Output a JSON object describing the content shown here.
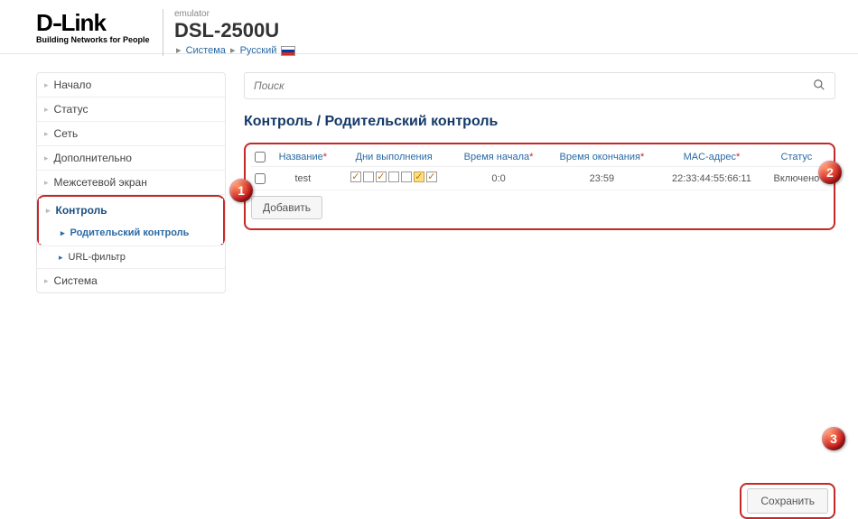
{
  "header": {
    "brand": "D-Link",
    "slogan": "Building Networks for People",
    "emulator": "emulator",
    "model": "DSL-2500U",
    "crumb_system": "Система",
    "crumb_lang": "Русский"
  },
  "sidebar": {
    "items": [
      {
        "label": "Начало"
      },
      {
        "label": "Статус"
      },
      {
        "label": "Сеть"
      },
      {
        "label": "Дополнительно"
      },
      {
        "label": "Межсетевой экран"
      },
      {
        "label": "Контроль"
      },
      {
        "label": "Родительский контроль"
      },
      {
        "label": "URL-фильтр"
      },
      {
        "label": "Система"
      }
    ]
  },
  "search": {
    "placeholder": "Поиск"
  },
  "title": "Контроль /  Родительский контроль",
  "columns": {
    "name": "Название",
    "days": "Дни выполнения",
    "start": "Время начала",
    "end": "Время окончания",
    "mac": "MAC-адрес",
    "status": "Статус"
  },
  "row": {
    "name": "test",
    "days": [
      true,
      false,
      true,
      false,
      false,
      true,
      true
    ],
    "highlight": [
      false,
      false,
      false,
      false,
      false,
      true,
      false
    ],
    "start": "0:0",
    "end": "23:59",
    "mac": "22:33:44:55:66:11",
    "status": "Включено"
  },
  "buttons": {
    "add": "Добавить",
    "save": "Сохранить"
  },
  "badges": {
    "b1": "1",
    "b2": "2",
    "b3": "3"
  }
}
